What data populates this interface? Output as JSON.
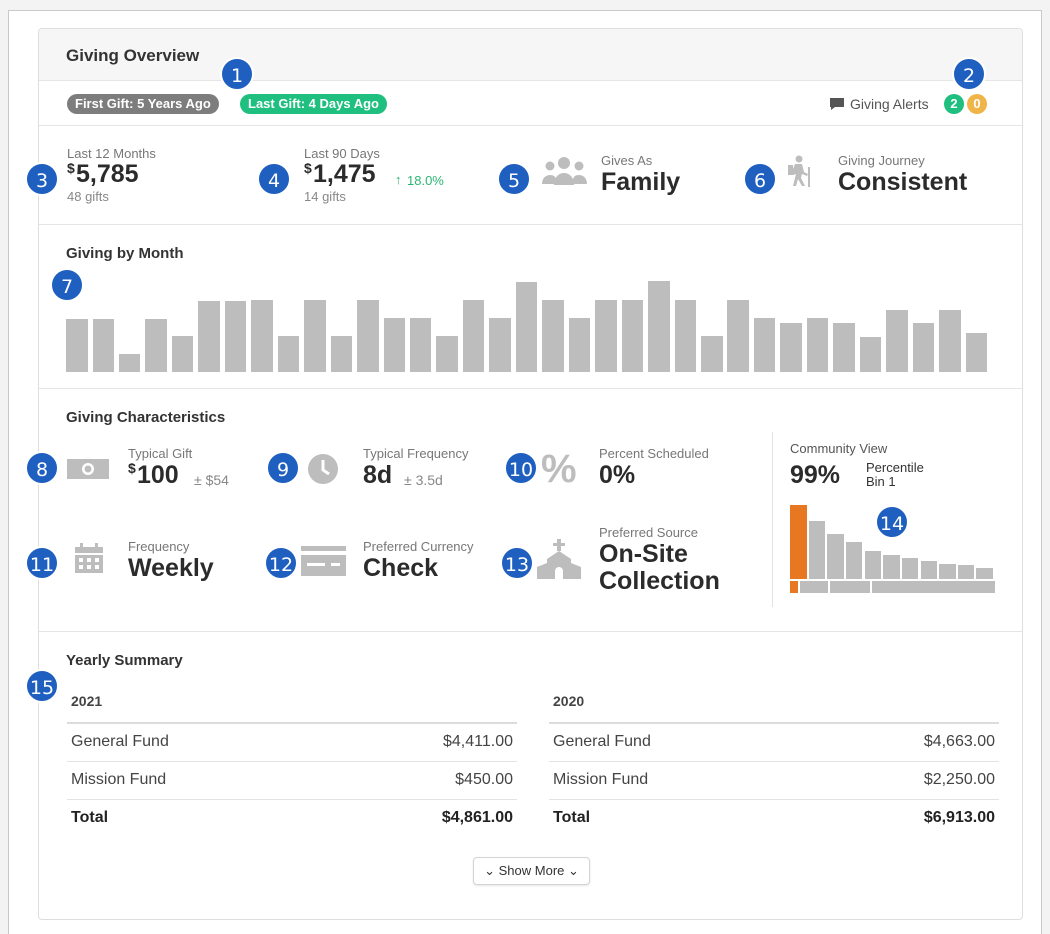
{
  "header": {
    "title": "Giving Overview",
    "first_gift": "First Gift: 5 Years Ago",
    "last_gift": "Last Gift: 4 Days Ago",
    "alerts_label": "Giving Alerts",
    "alerts_green": "2",
    "alerts_orange": "0"
  },
  "kpis": {
    "last12_label": "Last 12 Months",
    "last12_value": "5,785",
    "last12_currency": "$",
    "last12_gifts": "48 gifts",
    "last90_label": "Last 90 Days",
    "last90_value": "1,475",
    "last90_currency": "$",
    "last90_change": "18.0%",
    "last90_gifts": "14 gifts",
    "gives_as_label": "Gives As",
    "gives_as_value": "Family",
    "journey_label": "Giving Journey",
    "journey_value": "Consistent"
  },
  "giving_by_month": {
    "title": "Giving by Month",
    "chart_data": {
      "type": "bar",
      "values": [
        54,
        54,
        18,
        54,
        37,
        73,
        73,
        74,
        37,
        74,
        37,
        74,
        55,
        55,
        37,
        74,
        55,
        92,
        74,
        55,
        74,
        74,
        93,
        74,
        37,
        74,
        55,
        50,
        55,
        50,
        36,
        63,
        50,
        63,
        40
      ],
      "ylim": [
        0,
        100
      ],
      "color": "#bdbdbd"
    }
  },
  "characteristics": {
    "title": "Giving Characteristics",
    "typical_gift_label": "Typical Gift",
    "typical_gift_currency": "$",
    "typical_gift_value": "100",
    "typical_gift_dev": "± $54",
    "typical_freq_label": "Typical Frequency",
    "typical_freq_value": "8d",
    "typical_freq_dev": "± 3.5d",
    "pct_sched_label": "Percent Scheduled",
    "pct_sched_value": "0%",
    "frequency_label": "Frequency",
    "frequency_value": "Weekly",
    "currency_label": "Preferred Currency",
    "currency_value": "Check",
    "source_label": "Preferred Source",
    "source_value_line1": "On-Site",
    "source_value_line2": "Collection",
    "community_label": "Community View",
    "community_value": "99%",
    "percentile_label": "Percentile",
    "bin_label": "Bin 1",
    "community_chart": {
      "type": "bar",
      "values": [
        92,
        72,
        56,
        46,
        35,
        30,
        26,
        23,
        19,
        17,
        14
      ],
      "highlight_index": 0,
      "highlight_color": "#e87722",
      "color": "#bdbdbd"
    }
  },
  "yearly_summary": {
    "title": "Yearly Summary",
    "years": [
      {
        "year": "2021",
        "rows": [
          {
            "fund": "General Fund",
            "amount": "$4,411.00"
          },
          {
            "fund": "Mission Fund",
            "amount": "$450.00"
          }
        ],
        "total_label": "Total",
        "total": "$4,861.00"
      },
      {
        "year": "2020",
        "rows": [
          {
            "fund": "General Fund",
            "amount": "$4,663.00"
          },
          {
            "fund": "Mission Fund",
            "amount": "$2,250.00"
          }
        ],
        "total_label": "Total",
        "total": "$6,913.00"
      }
    ],
    "show_more": "Show More"
  },
  "markers": [
    "1",
    "2",
    "3",
    "4",
    "5",
    "6",
    "7",
    "8",
    "9",
    "10",
    "11",
    "12",
    "13",
    "14",
    "15"
  ],
  "colors": {
    "green": "#1fbf7f",
    "gray_pill": "#7d7d7d",
    "orange": "#f0b548",
    "marker_blue": "#1e5fbf",
    "up_green": "#2bb673"
  }
}
